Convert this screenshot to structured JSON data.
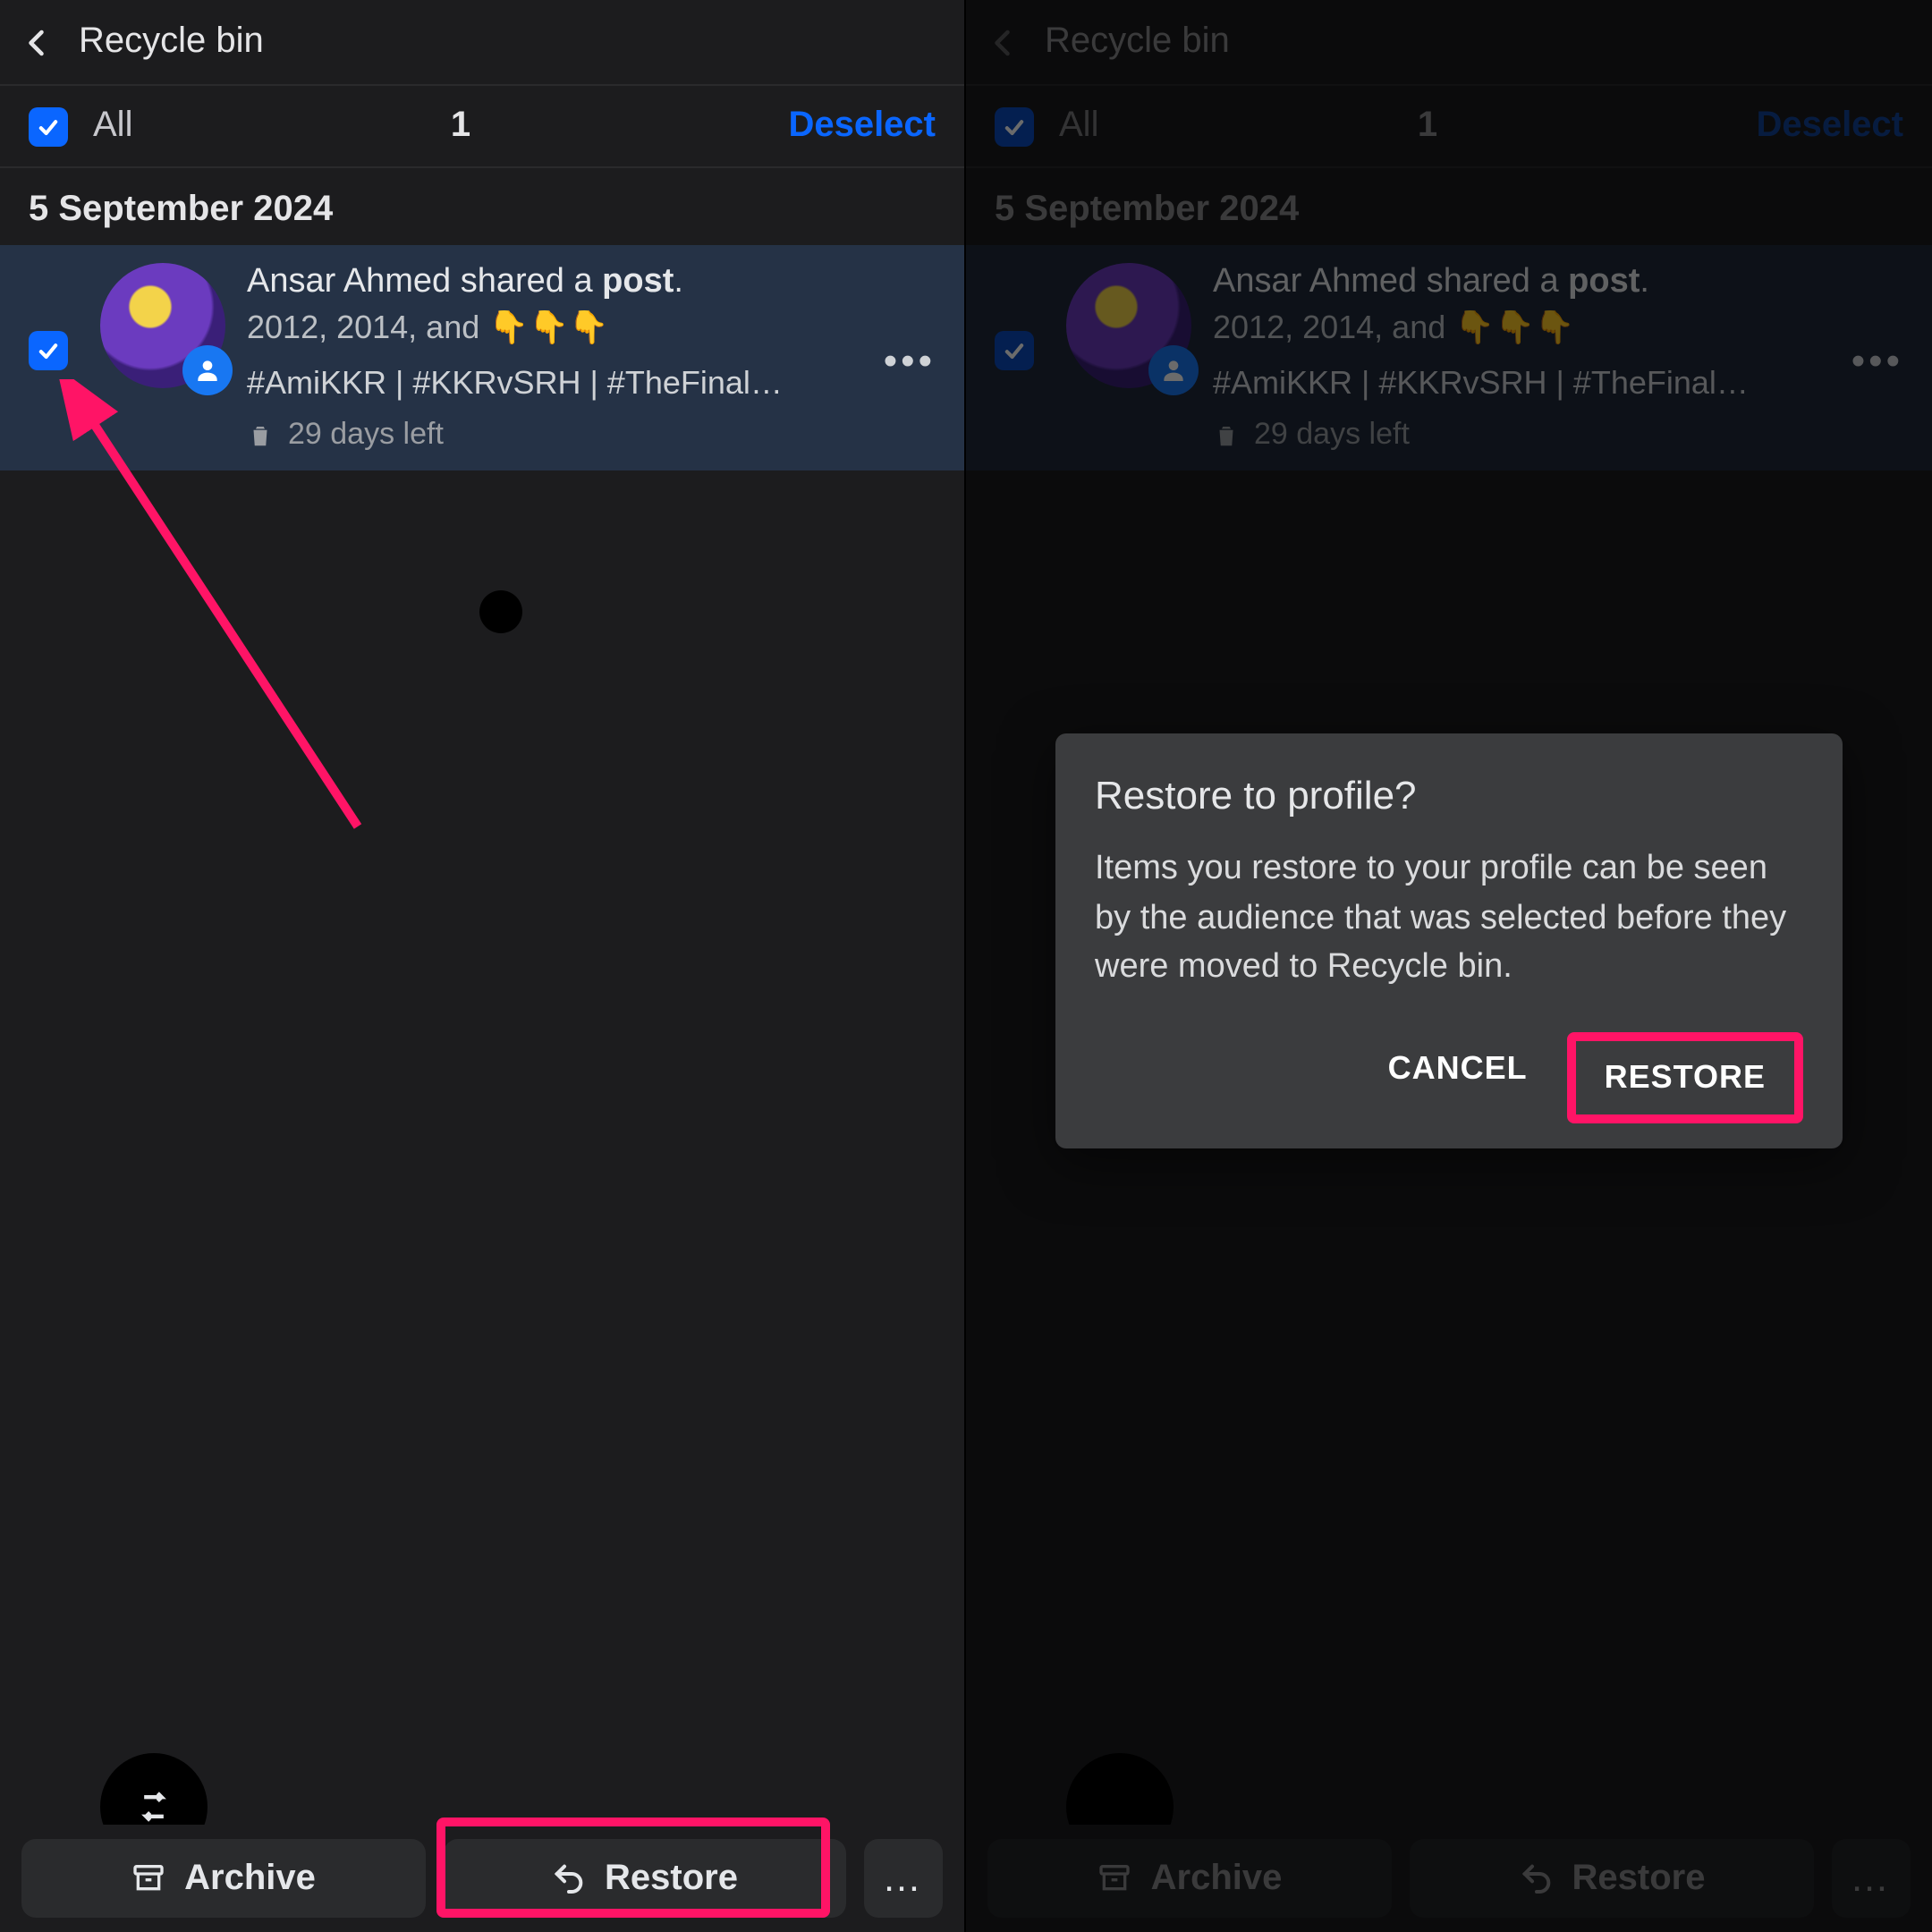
{
  "header": {
    "title": "Recycle bin"
  },
  "selectbar": {
    "all_label": "All",
    "count": "1",
    "deselect_label": "Deselect"
  },
  "date_group": "5 September 2024",
  "post": {
    "author": "Ansar Ahmed",
    "action_middle": " shared a ",
    "action_object": "post",
    "action_suffix": ".",
    "line2": "2012, 2014, and 👇👇👇",
    "line3": "#AmiKKR | #KKRvSRH | #TheFinal…",
    "days_left": "29 days left"
  },
  "buttons": {
    "archive": "Archive",
    "restore": "Restore",
    "more": "…"
  },
  "dialog": {
    "title": "Restore to profile?",
    "body": "Items you restore to your profile can be seen by the audience that was selected before they were moved to Recycle bin.",
    "cancel": "CANCEL",
    "restore": "RESTORE"
  }
}
